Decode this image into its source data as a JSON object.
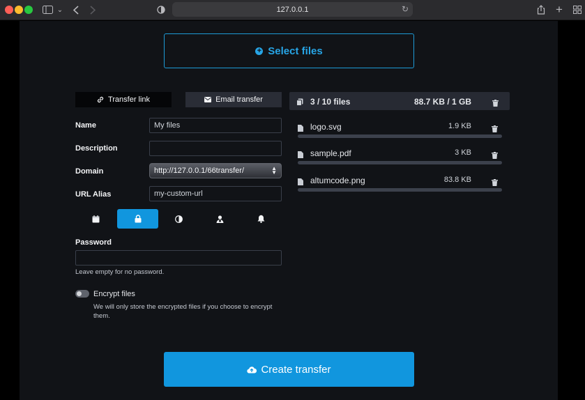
{
  "browser": {
    "url": "127.0.0.1"
  },
  "upload": {
    "select_label": "Select files"
  },
  "tabs": {
    "transfer_link": "Transfer link",
    "email_transfer": "Email transfer"
  },
  "form": {
    "name_label": "Name",
    "name_value": "My files",
    "description_label": "Description",
    "description_value": "",
    "domain_label": "Domain",
    "domain_value": "http://127.0.0.1/66transfer/",
    "alias_label": "URL Alias",
    "alias_placeholder": "my-custom-url",
    "settings_tabs": [
      "calendar-icon",
      "lock-icon",
      "contrast-icon",
      "user-icon",
      "bell-icon"
    ],
    "settings_active_index": 1,
    "password_label": "Password",
    "password_value": "",
    "password_help": "Leave empty for no password.",
    "encrypt_label": "Encrypt files",
    "encrypt_enabled": false,
    "encrypt_help": "We will only store the encrypted files if you choose to encrypt them."
  },
  "files": {
    "count": "3 / 10 files",
    "size": "88.7 KB / 1 GB",
    "items": [
      {
        "name": "logo.svg",
        "size": "1.9 KB"
      },
      {
        "name": "sample.pdf",
        "size": "3 KB"
      },
      {
        "name": "altumcode.png",
        "size": "83.8 KB"
      }
    ]
  },
  "actions": {
    "create_label": "Create transfer"
  },
  "colors": {
    "accent": "#1196de",
    "background": "#111317",
    "panel": "#272a33"
  }
}
